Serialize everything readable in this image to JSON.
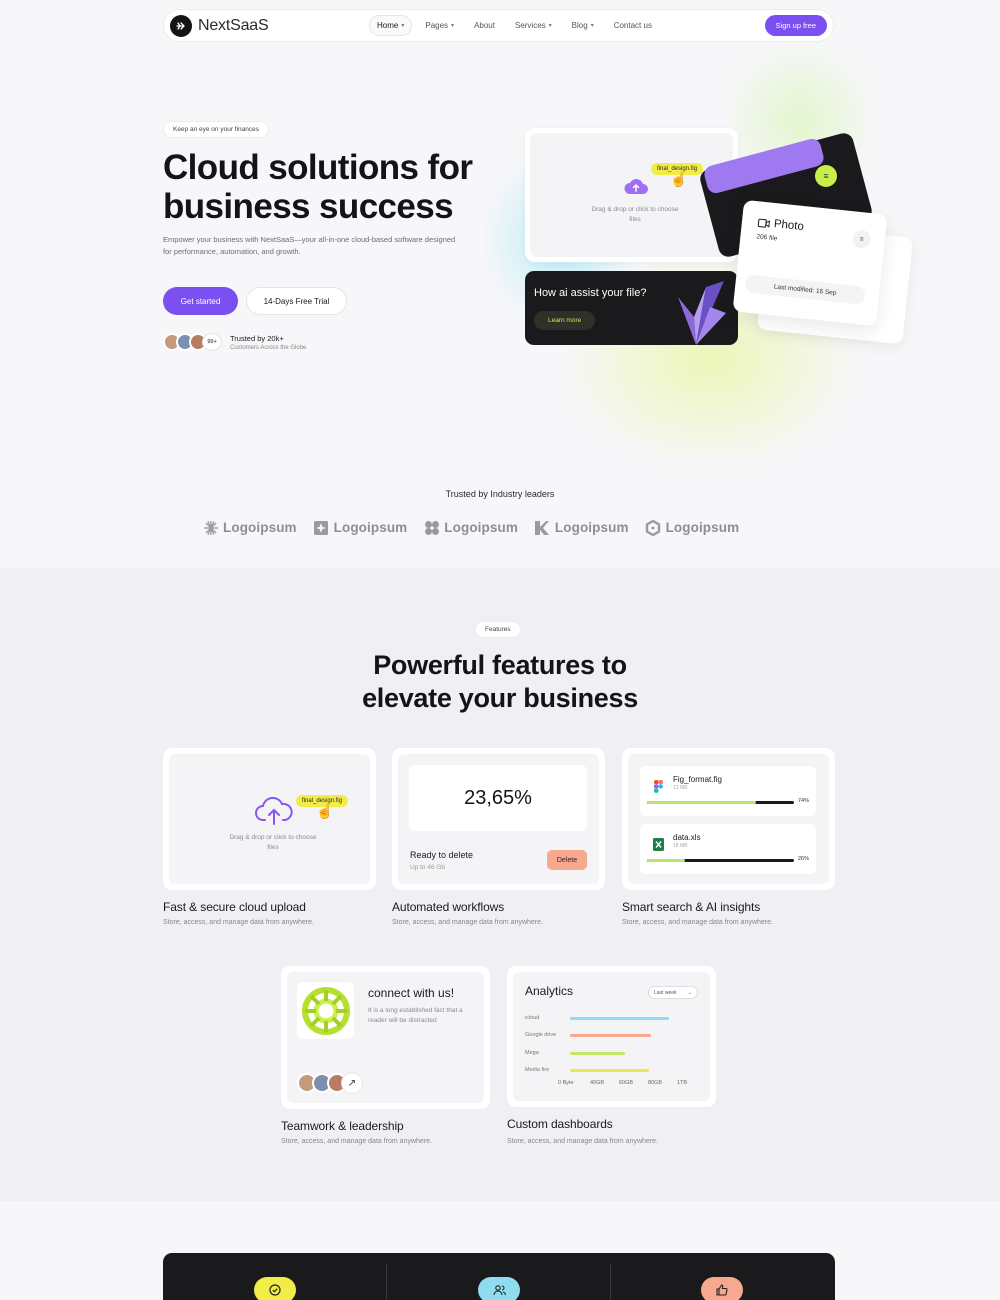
{
  "nav": {
    "logo_text": "NextSaaS",
    "links": [
      {
        "label": "Home",
        "dropdown": true
      },
      {
        "label": "Pages",
        "dropdown": true
      },
      {
        "label": "About",
        "dropdown": false
      },
      {
        "label": "Services",
        "dropdown": true
      },
      {
        "label": "Blog",
        "dropdown": true
      },
      {
        "label": "Contact us",
        "dropdown": false
      }
    ],
    "cta": "Sign up free"
  },
  "hero": {
    "tag": "Keep an eye on your finances",
    "title_line1": "Cloud solutions for",
    "title_line2": "business success",
    "subtitle": "Empower your business with NextSaaS—your all-in-one cloud-based software designed for performance, automation, and growth.",
    "primary_button": "Get started",
    "secondary_button": "14-Days Free Trial",
    "avatar_count": "99+",
    "trust_title": "Trusted by 20k+",
    "trust_subtitle": "Customers Across the Globe"
  },
  "hero_visual": {
    "upload_text": "Drag & drop or click to choose files",
    "file_chip": "final_design.fig",
    "ai_title": "How ai assist your file?",
    "ai_button": "Learn more",
    "photo_title": "Photo",
    "photo_count": "206 file",
    "photo_modified": "Last modified: 16 Sep"
  },
  "trusted": {
    "heading": "Trusted by Industry leaders",
    "logos": [
      "Logoipsum",
      "Logoipsum",
      "Logoipsum",
      "Logoipsum",
      "Logoipsum"
    ]
  },
  "features": {
    "tag": "Features",
    "heading_line1": "Powerful features to",
    "heading_line2": "elevate your business",
    "cards": [
      {
        "title": "Fast & secure cloud upload",
        "subtitle": "Store, access, and manage data from anywhere."
      },
      {
        "title": "Automated workflows",
        "subtitle": "Store, access, and manage data from anywhere."
      },
      {
        "title": "Smart search & AI insights",
        "subtitle": "Store, access, and manage data from anywhere."
      },
      {
        "title": "Teamwork & leadership",
        "subtitle": "Store, access, and manage data from anywhere."
      },
      {
        "title": "Custom dashboards",
        "subtitle": "Store, access, and manage data from anywhere."
      }
    ],
    "upload": {
      "text": "Drag & drop or click to choose files",
      "chip": "final_design.fig"
    },
    "workflow": {
      "percent": "23,65%",
      "ready_label": "Ready to delete",
      "size_label": "Up to 46 Gb",
      "delete_button": "Delete"
    },
    "files": [
      {
        "name": "Fig_format.fig",
        "size": "13 MB",
        "progress": 0.74,
        "percent_label": "74%"
      },
      {
        "name": "data.xls",
        "size": "18 MB",
        "progress": 0.26,
        "percent_label": "26%"
      }
    ],
    "connect": {
      "title": "connect with us!",
      "text": "It is a long established fact that a reader will be distracted"
    },
    "analytics": {
      "title": "Analytics",
      "range": "Last week",
      "rows": [
        {
          "label": "icloud",
          "value": 0.72,
          "color": "#8fdcf0"
        },
        {
          "label": "Google drive",
          "value": 0.59,
          "color": "#f6a98f"
        },
        {
          "label": "Mega",
          "value": 0.4,
          "color": "#c2e86a"
        },
        {
          "label": "Media fire",
          "value": 0.57,
          "color": "#efe45a"
        }
      ],
      "ticks": [
        "0 Byte",
        "40GB",
        "60GB",
        "80GB",
        "1TB"
      ]
    }
  },
  "colors": {
    "accent": "#7c4ff0",
    "lime": "#c9ef4a",
    "yellow": "#f2ec49",
    "coral": "#f6a98f",
    "cyan": "#8fdcf0",
    "dark": "#1a1a1c"
  }
}
